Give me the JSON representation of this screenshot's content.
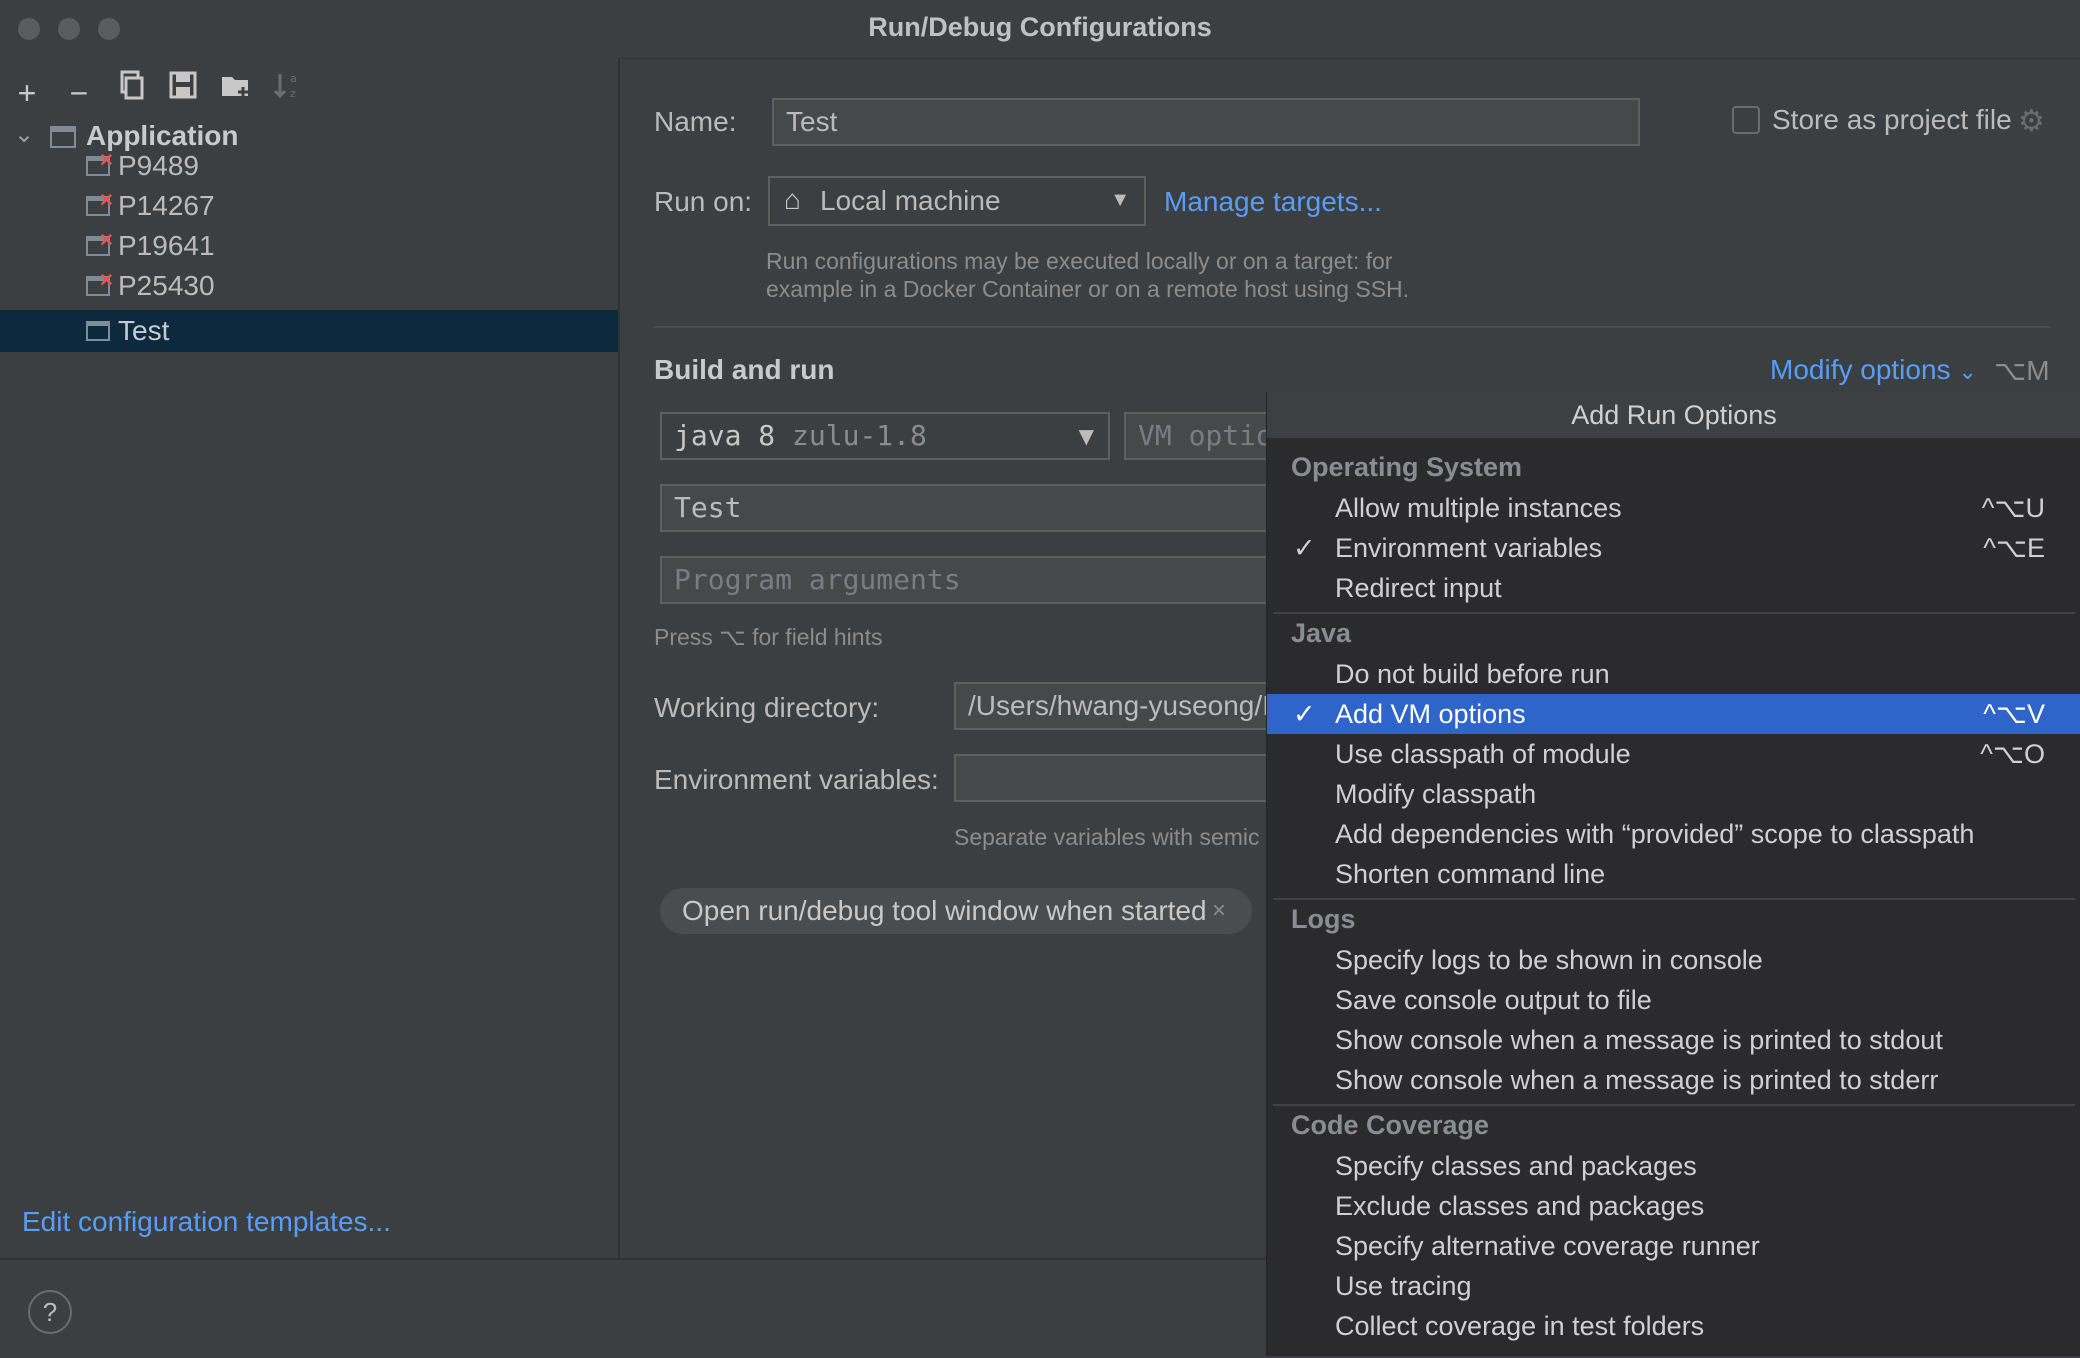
{
  "window": {
    "title": "Run/Debug Configurations"
  },
  "tree": {
    "root_label": "Application",
    "items": [
      {
        "label": "P9489",
        "error": true
      },
      {
        "label": "P14267",
        "error": true
      },
      {
        "label": "P19641",
        "error": true
      },
      {
        "label": "P25430",
        "error": true
      },
      {
        "label": "Test",
        "error": false,
        "selected": true
      }
    ]
  },
  "left_footer": {
    "edit_templates": "Edit configuration templates..."
  },
  "form": {
    "name_label": "Name:",
    "name_value": "Test",
    "store_project_label": "Store as project file",
    "run_on_label": "Run on:",
    "run_on_value": "Local machine",
    "manage_targets": "Manage targets...",
    "run_on_hint_1": "Run configurations may be executed locally or on a target: for",
    "run_on_hint_2": "example in a Docker Container or on a remote host using SSH.",
    "build_run_title": "Build and run",
    "modify_options": "Modify options",
    "modify_shortcut": "⌥M",
    "jdk_value": "java 8",
    "jdk_detail": "zulu-1.8",
    "vm_options_placeholder": "VM optio",
    "main_class": "Test",
    "program_args_placeholder": "Program arguments",
    "field_hints": "Press ⌥ for field hints",
    "working_dir_label": "Working directory:",
    "working_dir_value": "/Users/hwang-yuseong/I",
    "env_vars_label": "Environment variables:",
    "env_vars_hint": "Separate variables with semic",
    "tag_open_window": "Open run/debug tool window when started"
  },
  "popup": {
    "title": "Add Run Options",
    "sections": [
      {
        "title": "Operating System",
        "options": [
          {
            "label": "Allow multiple instances",
            "shortcut": "^⌥U",
            "checked": false
          },
          {
            "label": "Environment variables",
            "shortcut": "^⌥E",
            "checked": true
          },
          {
            "label": "Redirect input",
            "shortcut": "",
            "checked": false
          }
        ]
      },
      {
        "title": "Java",
        "options": [
          {
            "label": "Do not build before run",
            "shortcut": "",
            "checked": false
          },
          {
            "label": "Add VM options",
            "shortcut": "^⌥V",
            "checked": true,
            "active": true
          },
          {
            "label": "Use classpath of module",
            "shortcut": "^⌥O",
            "checked": false
          },
          {
            "label": "Modify classpath",
            "shortcut": "",
            "checked": false
          },
          {
            "label": "Add dependencies with “provided” scope to classpath",
            "shortcut": "",
            "checked": false
          },
          {
            "label": "Shorten command line",
            "shortcut": "",
            "checked": false
          }
        ]
      },
      {
        "title": "Logs",
        "options": [
          {
            "label": "Specify logs to be shown in console",
            "shortcut": "",
            "checked": false
          },
          {
            "label": "Save console output to file",
            "shortcut": "",
            "checked": false
          },
          {
            "label": "Show console when a message is printed to stdout",
            "shortcut": "",
            "checked": false
          },
          {
            "label": "Show console when a message is printed to stderr",
            "shortcut": "",
            "checked": false
          }
        ]
      },
      {
        "title": "Code Coverage",
        "options": [
          {
            "label": "Specify classes and packages",
            "shortcut": "",
            "checked": false
          },
          {
            "label": "Exclude classes and packages",
            "shortcut": "",
            "checked": false
          },
          {
            "label": "Specify alternative coverage runner",
            "shortcut": "",
            "checked": false
          },
          {
            "label": "Use tracing",
            "shortcut": "",
            "checked": false
          },
          {
            "label": "Collect coverage in test folders",
            "shortcut": "",
            "checked": false
          }
        ]
      }
    ]
  },
  "colors": {
    "accent": "#589df6",
    "selection": "#2f65ca",
    "tree_selection": "#0d293e",
    "error": "#e25656"
  }
}
